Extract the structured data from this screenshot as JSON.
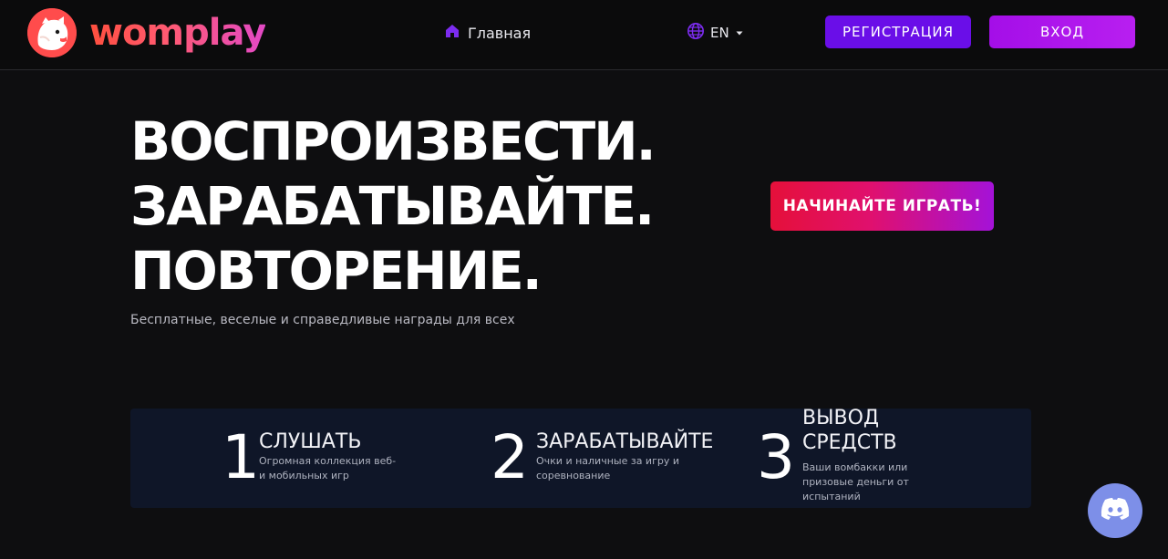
{
  "header": {
    "logo_text": "womplay",
    "nav_home": "Главная",
    "lang": "EN",
    "register": "РЕГИСТРАЦИЯ",
    "login": "ВХОД"
  },
  "hero": {
    "lines": [
      "ВОСПРОИЗВЕСТИ.",
      "ЗАРАБАТЫВАЙТЕ.",
      "ПОВТОРЕНИЕ."
    ],
    "subtitle": "Бесплатные, веселые и справедливые награды для всех",
    "cta": "НАЧИНАЙТЕ ИГРАТЬ!"
  },
  "steps": [
    {
      "num": "1",
      "title": "СЛУШАТЬ",
      "desc_lines": [
        "Огромная коллекция веб-",
        "и мобильных игр"
      ]
    },
    {
      "num": "2",
      "title": "ЗАРАБАТЫВАЙТЕ",
      "desc_lines": [
        "Очки и наличные за игру и",
        "соревнование"
      ]
    },
    {
      "num": "3",
      "title_lines": [
        "ВЫВОД",
        "СРЕДСТВ"
      ],
      "desc_lines": [
        "Ваши вомбакки или",
        "призовые деньги от",
        "испытаний"
      ]
    }
  ],
  "icons": {
    "home": "home-icon",
    "globe": "globe-icon",
    "caret": "caret-down-icon",
    "discord": "discord-icon"
  },
  "colors": {
    "accent_purple": "#6a0ee8",
    "accent_magenta": "#b81ff0",
    "cta_red": "#e5103a",
    "brand_coral": "#ff4f3e",
    "discord": "#7d8fe8"
  }
}
